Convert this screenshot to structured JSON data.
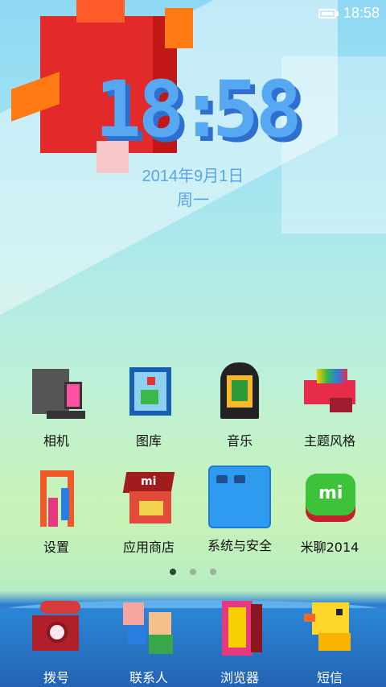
{
  "status_bar": {
    "time": "18:58",
    "battery_icon": "battery-icon"
  },
  "clock": {
    "hours": "18",
    "separator": ":",
    "minutes": "58",
    "date": "2014年9月1日",
    "weekday": "周一"
  },
  "apps": [
    {
      "label": "相机",
      "icon": "camera-icon"
    },
    {
      "label": "图库",
      "icon": "gallery-icon"
    },
    {
      "label": "音乐",
      "icon": "music-icon"
    },
    {
      "label": "主题风格",
      "icon": "theme-icon"
    },
    {
      "label": "设置",
      "icon": "settings-icon"
    },
    {
      "label": "应用商店",
      "icon": "app-store-icon"
    },
    {
      "label": "系统与安全",
      "icon": "security-folder-icon"
    },
    {
      "label": "米聊2014",
      "icon": "miliao-icon"
    }
  ],
  "page_indicator": {
    "count": 3,
    "active": 0
  },
  "dock": [
    {
      "label": "拨号",
      "icon": "phone-icon"
    },
    {
      "label": "联系人",
      "icon": "contacts-icon"
    },
    {
      "label": "浏览器",
      "icon": "browser-icon"
    },
    {
      "label": "短信",
      "icon": "sms-icon"
    }
  ],
  "store_logo_text": "mi",
  "miliao_logo_text": "mi",
  "colors": {
    "clock": "#56a8f2",
    "date": "#58a5ee",
    "dock_water": "#2a74c4"
  }
}
